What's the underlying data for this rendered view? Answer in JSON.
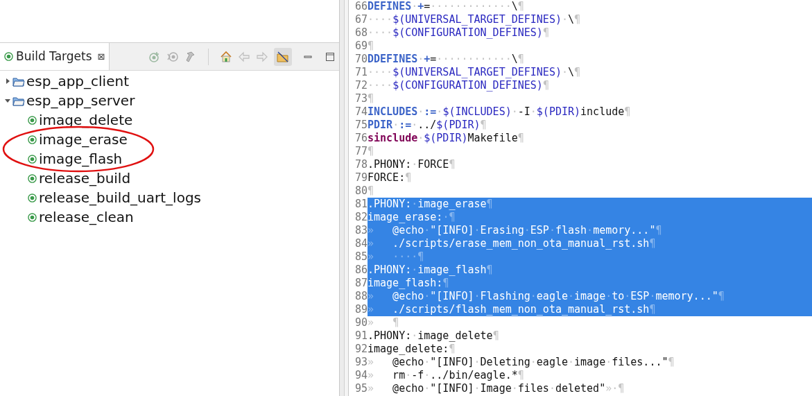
{
  "view": {
    "title": "Build Targets",
    "close_glyph": "⊠"
  },
  "tree": [
    {
      "label": "esp_app_client",
      "expanded": false
    },
    {
      "label": "esp_app_server",
      "expanded": true,
      "children": [
        {
          "label": "image_delete"
        },
        {
          "label": "image_erase"
        },
        {
          "label": "image_flash"
        },
        {
          "label": "release_build"
        },
        {
          "label": "release_build_uart_logs"
        },
        {
          "label": "release_clean"
        }
      ]
    }
  ],
  "editor": {
    "lines": [
      {
        "number": "66",
        "selected": false,
        "segments": [
          {
            "kind": "keyword",
            "text": "DEFINES"
          },
          {
            "kind": "operator",
            "text": "·+"
          },
          {
            "kind": "plain",
            "text": "=·············\\¶"
          }
        ]
      },
      {
        "number": "67",
        "selected": false,
        "segments": [
          {
            "kind": "plain",
            "text": "····"
          },
          {
            "kind": "variable",
            "text": "$(UNIVERSAL_TARGET_DEFINES)"
          },
          {
            "kind": "plain",
            "text": "·\\¶"
          }
        ]
      },
      {
        "number": "68",
        "selected": false,
        "segments": [
          {
            "kind": "plain",
            "text": "····"
          },
          {
            "kind": "variable",
            "text": "$(CONFIGURATION_DEFINES)"
          },
          {
            "kind": "plain",
            "text": "¶"
          }
        ]
      },
      {
        "number": "69",
        "selected": false,
        "segments": [
          {
            "kind": "plain",
            "text": "¶"
          }
        ]
      },
      {
        "number": "70",
        "selected": false,
        "segments": [
          {
            "kind": "keyword",
            "text": "DDEFINES"
          },
          {
            "kind": "operator",
            "text": "·+"
          },
          {
            "kind": "plain",
            "text": "=············\\¶"
          }
        ]
      },
      {
        "number": "71",
        "selected": false,
        "segments": [
          {
            "kind": "plain",
            "text": "····"
          },
          {
            "kind": "variable",
            "text": "$(UNIVERSAL_TARGET_DEFINES)"
          },
          {
            "kind": "plain",
            "text": "·\\¶"
          }
        ]
      },
      {
        "number": "72",
        "selected": false,
        "segments": [
          {
            "kind": "plain",
            "text": "····"
          },
          {
            "kind": "variable",
            "text": "$(CONFIGURATION_DEFINES)"
          },
          {
            "kind": "plain",
            "text": "¶"
          }
        ]
      },
      {
        "number": "73",
        "selected": false,
        "segments": [
          {
            "kind": "plain",
            "text": "¶"
          }
        ]
      },
      {
        "number": "74",
        "selected": false,
        "segments": [
          {
            "kind": "keyword",
            "text": "INCLUDES"
          },
          {
            "kind": "operator",
            "text": "·:="
          },
          {
            "kind": "plain",
            "text": "·"
          },
          {
            "kind": "variable",
            "text": "$(INCLUDES)"
          },
          {
            "kind": "plain",
            "text": "·-I·"
          },
          {
            "kind": "variable",
            "text": "$(PDIR)"
          },
          {
            "kind": "plain",
            "text": "include¶"
          }
        ]
      },
      {
        "number": "75",
        "selected": false,
        "segments": [
          {
            "kind": "keyword",
            "text": "PDIR"
          },
          {
            "kind": "operator",
            "text": "·:="
          },
          {
            "kind": "plain",
            "text": "·../"
          },
          {
            "kind": "variable",
            "text": "$(PDIR)"
          },
          {
            "kind": "plain",
            "text": "¶"
          }
        ]
      },
      {
        "number": "76",
        "selected": false,
        "segments": [
          {
            "kind": "directive",
            "text": "sinclude"
          },
          {
            "kind": "plain",
            "text": "·"
          },
          {
            "kind": "variable",
            "text": "$(PDIR)"
          },
          {
            "kind": "plain",
            "text": "Makefile¶"
          }
        ]
      },
      {
        "number": "77",
        "selected": false,
        "segments": [
          {
            "kind": "plain",
            "text": "¶"
          }
        ]
      },
      {
        "number": "78",
        "selected": false,
        "segments": [
          {
            "kind": "plain",
            "text": ".PHONY:·FORCE¶"
          }
        ]
      },
      {
        "number": "79",
        "selected": false,
        "segments": [
          {
            "kind": "plain",
            "text": "FORCE:¶"
          }
        ]
      },
      {
        "number": "80",
        "selected": false,
        "segments": [
          {
            "kind": "plain",
            "text": "¶"
          }
        ]
      },
      {
        "number": "81",
        "selected": true,
        "segments": [
          {
            "kind": "plain",
            "text": ".PHONY:·image_erase¶"
          }
        ]
      },
      {
        "number": "82",
        "selected": true,
        "segments": [
          {
            "kind": "plain",
            "text": "image_erase:·¶"
          }
        ]
      },
      {
        "number": "83",
        "selected": true,
        "segments": [
          {
            "kind": "plain",
            "text": "»   @echo·\"[INFO]·Erasing·ESP·flash·memory...\"¶"
          }
        ]
      },
      {
        "number": "84",
        "selected": true,
        "segments": [
          {
            "kind": "plain",
            "text": "»   ./scripts/erase_mem_non_ota_manual_rst.sh¶"
          }
        ]
      },
      {
        "number": "85",
        "selected": true,
        "segments": [
          {
            "kind": "plain",
            "text": "»   ····¶"
          }
        ]
      },
      {
        "number": "86",
        "selected": true,
        "segments": [
          {
            "kind": "plain",
            "text": ".PHONY:·image_flash¶"
          }
        ]
      },
      {
        "number": "87",
        "selected": true,
        "segments": [
          {
            "kind": "plain",
            "text": "image_flash:¶"
          }
        ]
      },
      {
        "number": "88",
        "selected": true,
        "segments": [
          {
            "kind": "plain",
            "text": "»   @echo·\"[INFO]·Flashing·eagle·image·to·ESP·memory...\"¶"
          }
        ]
      },
      {
        "number": "89",
        "selected": true,
        "segments": [
          {
            "kind": "plain",
            "text": "»   ./scripts/flash_mem_non_ota_manual_rst.sh¶"
          }
        ]
      },
      {
        "number": "90",
        "selected": false,
        "segments": [
          {
            "kind": "plain",
            "text": "»   ¶"
          }
        ]
      },
      {
        "number": "91",
        "selected": false,
        "segments": [
          {
            "kind": "plain",
            "text": ".PHONY:·image_delete¶"
          }
        ]
      },
      {
        "number": "92",
        "selected": false,
        "segments": [
          {
            "kind": "plain",
            "text": "image_delete:¶"
          }
        ]
      },
      {
        "number": "93",
        "selected": false,
        "segments": [
          {
            "kind": "plain",
            "text": "»   @echo·\"[INFO]·Deleting·eagle·image·files...\"¶"
          }
        ]
      },
      {
        "number": "94",
        "selected": false,
        "segments": [
          {
            "kind": "plain",
            "text": "»   rm·-f·../bin/eagle.*¶"
          }
        ]
      },
      {
        "number": "95",
        "selected": false,
        "segments": [
          {
            "kind": "plain",
            "text": "»   @echo·\"[INFO]·Image·files·deleted\"»·¶"
          }
        ]
      }
    ]
  }
}
